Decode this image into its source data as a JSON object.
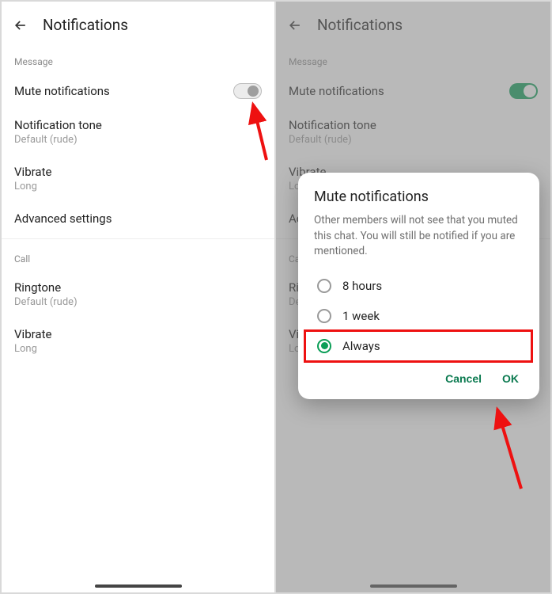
{
  "colors": {
    "accent": "#0b9e57",
    "annotation": "#e11"
  },
  "left": {
    "header": {
      "title": "Notifications"
    },
    "section_message": "Message",
    "mute": {
      "label": "Mute notifications",
      "on": false
    },
    "tone": {
      "label": "Notification tone",
      "value": "Default (rude)"
    },
    "vibrate_msg": {
      "label": "Vibrate",
      "value": "Long"
    },
    "advanced": {
      "label": "Advanced settings"
    },
    "section_call": "Call",
    "ringtone": {
      "label": "Ringtone",
      "value": "Default (rude)"
    },
    "vibrate_call": {
      "label": "Vibrate",
      "value": "Long"
    }
  },
  "right": {
    "header": {
      "title": "Notifications"
    },
    "section_message": "Message",
    "mute": {
      "label": "Mute notifications",
      "on": true
    },
    "tone": {
      "label": "Notification tone",
      "value": "Default (rude)"
    },
    "vibrate_msg": {
      "label": "Vibrate",
      "value": "Long"
    },
    "advanced": {
      "label": "Advanced settings"
    },
    "section_call": "Call",
    "ringtone": {
      "label": "Ringtone",
      "value": "Default (rude)"
    },
    "vibrate_call": {
      "label": "Vibrate",
      "value": "Long"
    },
    "dialog": {
      "title": "Mute notifications",
      "body": "Other members will not see that you muted this chat. You will still be notified if you are mentioned.",
      "options": [
        {
          "label": "8 hours",
          "selected": false
        },
        {
          "label": "1 week",
          "selected": false
        },
        {
          "label": "Always",
          "selected": true
        }
      ],
      "cancel": "Cancel",
      "ok": "OK"
    }
  }
}
